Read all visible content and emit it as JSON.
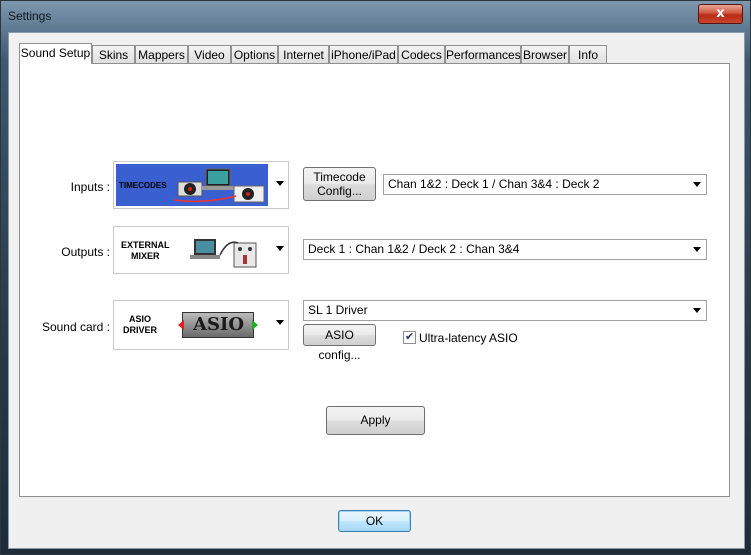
{
  "window": {
    "title": "Settings",
    "close_glyph": "x"
  },
  "tabs": [
    {
      "label": "Sound Setup",
      "active": true
    },
    {
      "label": "Skins"
    },
    {
      "label": "Mappers"
    },
    {
      "label": "Video"
    },
    {
      "label": "Options"
    },
    {
      "label": "Internet"
    },
    {
      "label": "iPhone/iPad"
    },
    {
      "label": "Codecs"
    },
    {
      "label": "Performances"
    },
    {
      "label": "Browser"
    },
    {
      "label": "Info"
    }
  ],
  "inputs": {
    "label": "Inputs :",
    "image_text": "TIMECODES",
    "timecode_button": [
      "Timecode",
      "Config..."
    ],
    "select_value": "Chan 1&2 : Deck 1 / Chan 3&4 : Deck 2"
  },
  "outputs": {
    "label": "Outputs :",
    "image_text": [
      "EXTERNAL",
      "MIXER"
    ],
    "select_value": "Deck 1 : Chan 1&2 / Deck 2 : Chan 3&4"
  },
  "soundcard": {
    "label": "Sound card :",
    "image_text": [
      "ASIO",
      "DRIVER"
    ],
    "logo_text": "ASIO",
    "select_value": "SL 1 Driver",
    "asio_config_button": "ASIO config...",
    "ultra_latency_label": "Ultra-latency ASIO",
    "ultra_latency_checked": true
  },
  "buttons": {
    "apply": "Apply",
    "ok": "OK"
  },
  "colors": {
    "timecode_bg": "#3a5fd0",
    "close_red": "#c8462e",
    "ok_border": "#3c7fb1"
  }
}
